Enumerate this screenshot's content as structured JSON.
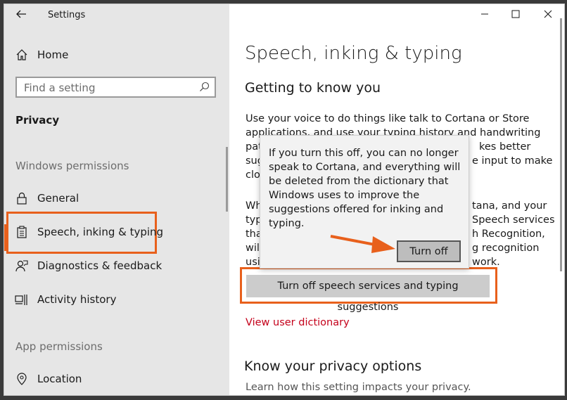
{
  "window": {
    "title": "Settings",
    "back_icon": "back-arrow-icon",
    "controls": [
      "minimize-icon",
      "maximize-icon",
      "close-icon"
    ]
  },
  "sidebar": {
    "home_label": "Home",
    "search_placeholder": "Find a setting",
    "category": "Privacy",
    "windows_permissions_label": "Windows permissions",
    "items": [
      {
        "label": "General",
        "icon": "lock-icon"
      },
      {
        "label": "Speech, inking & typing",
        "icon": "clipboard-icon",
        "selected": true
      },
      {
        "label": "Diagnostics & feedback",
        "icon": "feedback-person-icon"
      },
      {
        "label": "Activity history",
        "icon": "activity-history-icon"
      }
    ],
    "app_permissions_label": "App permissions",
    "app_items": [
      {
        "label": "Location",
        "icon": "location-pin-icon"
      }
    ]
  },
  "main": {
    "page_title": "Speech, inking & typing",
    "section1_title": "Getting to know you",
    "para1_lines": [
      "Use your voice to do things like talk to Cortana or Store",
      "applications, and use your typing history and handwriting",
      "patt",
      "kes better",
      "sug",
      "e input to make",
      "clou"
    ],
    "para2_lines": [
      "Whe",
      "tana, and your",
      "typi",
      "Speech services",
      "that",
      "h Recognition,",
      "will",
      "g recognition",
      "usin",
      "work."
    ],
    "turn_off_services_button": "Turn off speech services and typing suggestions",
    "view_dictionary_link": "View user dictionary",
    "section2_title": "Know your privacy options",
    "section2_desc": "Learn how this setting impacts your privacy."
  },
  "flyout": {
    "message": "If you turn this off, you can no longer speak to Cortana, and everything will be deleted from the dictionary that Windows uses to improve the suggestions offered for inking and typing.",
    "turn_off_button": "Turn off"
  },
  "colors": {
    "highlight": "#e8601c",
    "link": "#c4001a",
    "sidebar_bg": "#e6e6e6"
  }
}
